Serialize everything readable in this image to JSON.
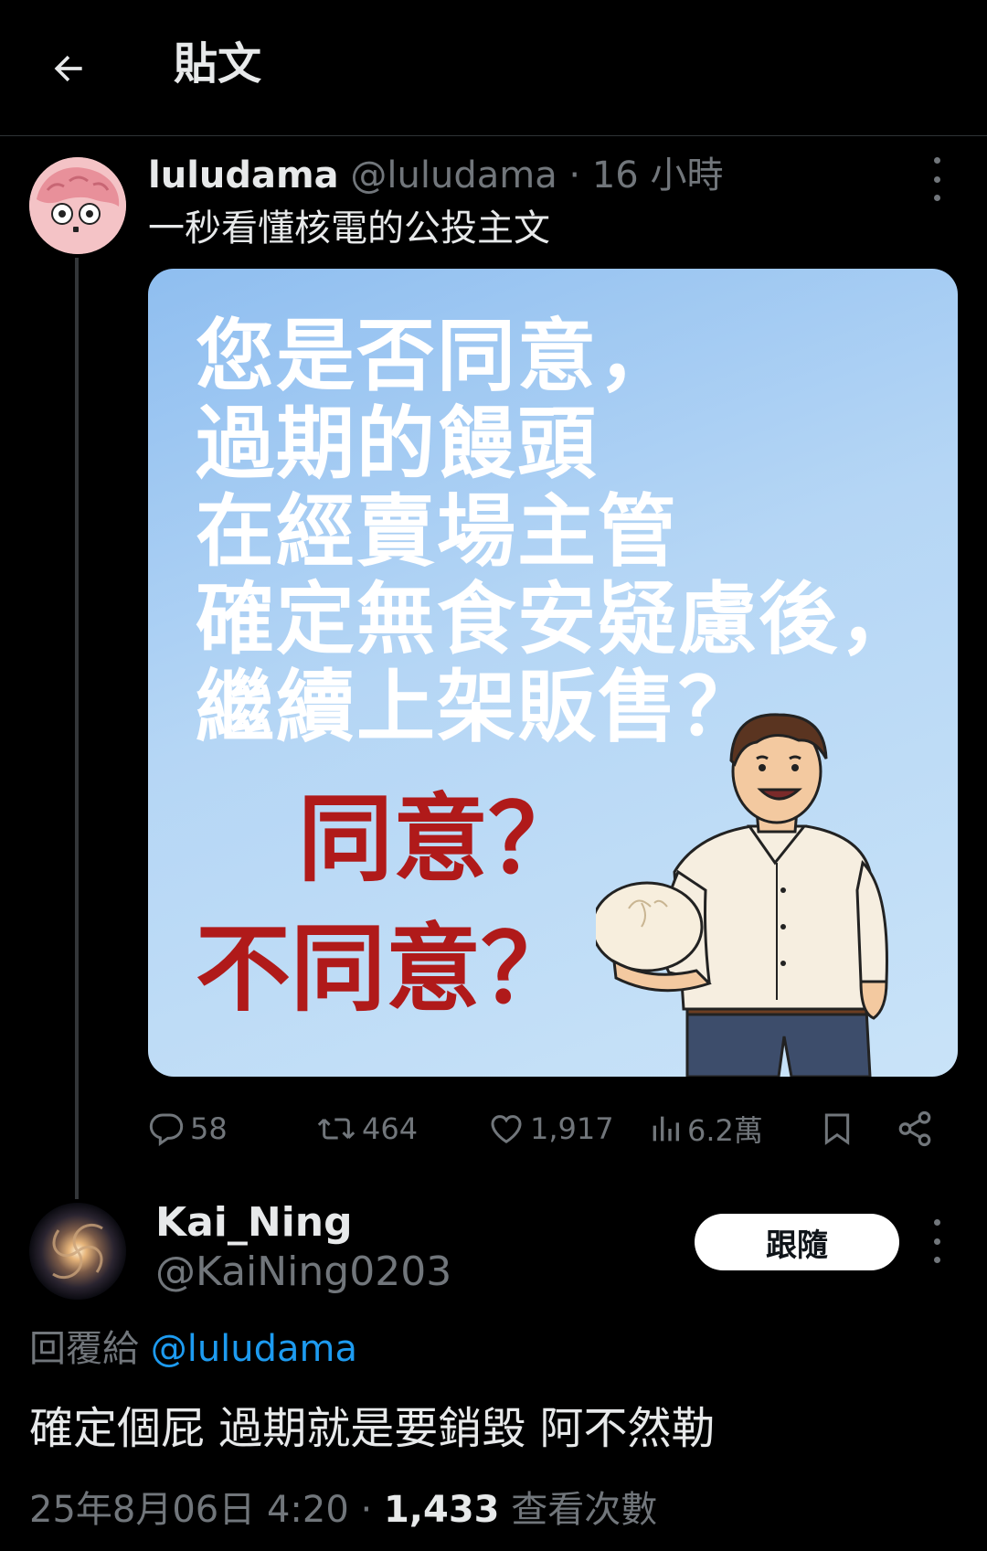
{
  "header": {
    "title": "貼文"
  },
  "tweet": {
    "name": "luludama",
    "handle": "@luludama",
    "separator": "·",
    "time": "16 小時",
    "text": "一秒看懂核電的公投主文",
    "image": {
      "question_lines": [
        "您是否同意，",
        "過期的饅頭",
        "在經賣場主管",
        "確定無食安疑慮後，",
        "繼續上架販售？"
      ],
      "answer_yes": "同意？",
      "answer_no": "不同意？"
    },
    "stats": {
      "replies": "58",
      "retweets": "464",
      "likes": "1,917",
      "views": "6.2萬"
    }
  },
  "reply": {
    "name": "Kai_Ning",
    "handle": "@KaiNing0203",
    "follow_label": "跟隨",
    "reply_to_prefix": "回覆給 ",
    "reply_to_mention": "@luludama",
    "text": "確定個屁 過期就是要銷毀 阿不然勒",
    "date": "25年8月06日 4:20",
    "separator": " · ",
    "views": "1,433",
    "views_label": " 查看次數"
  },
  "colors": {
    "background": "#000000",
    "accent": "#1d9bf0",
    "muted": "#71767b",
    "poll_answer": "#b01a1a"
  },
  "icons": [
    "back-arrow-icon",
    "more-icon",
    "reply-icon",
    "retweet-icon",
    "like-icon",
    "views-icon",
    "bookmark-icon",
    "share-icon"
  ]
}
